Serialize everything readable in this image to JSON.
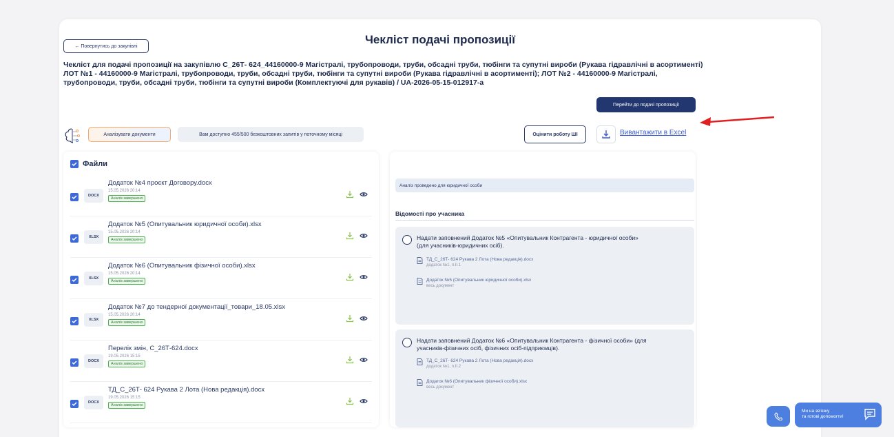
{
  "page": {
    "title": "Чекліст подачі пропозиції",
    "back_label": "← Повернутись до закупівлі",
    "heading": "Чекліст для подачі пропозиції на закупівлю С_26Т- 624_44160000-9 Магістралі, трубопроводи, труби, обсадні труби, тюбінги та супутні вироби (Рукава гідравлічні в асортименті) ЛОТ №1 - 44160000-9 Магістралі, трубопроводи, труби, обсадні труби, тюбінги та супутні вироби (Рукава гідравлічні в асортименті); ЛОТ №2 - 44160000-9 Магістралі, трубопроводи, труби, обсадні труби, тюбінги та супутні вироби (Комплектуючі для рукавів) / UA-2026-05-15-012917-a",
    "submit_label": "Перейти до подачі пропозиції"
  },
  "toolbar": {
    "analyze_label": "Аналізувати документи",
    "quota_text": "Вам доступно 455/500 безкоштовних запитів у поточному місяці",
    "rate_label": "Оцінити роботу ШІ",
    "export_label": "Вивантажити в Excel"
  },
  "files": {
    "header": "Файли",
    "items": [
      {
        "ext": "DOCX",
        "name": "Додаток №4 проєкт Договору.docx",
        "date": "15.05.2026 20:14",
        "status": "Аналіз завершено"
      },
      {
        "ext": "XLSX",
        "name": "Додаток №5 (Опитувальник юридичної особи).xlsx",
        "date": "15.05.2026 20:14",
        "status": "Аналіз завершено"
      },
      {
        "ext": "XLSX",
        "name": "Додаток №6 (Опитувальник фізичної особи).xlsx",
        "date": "15.05.2026 20:14",
        "status": "Аналіз завершено"
      },
      {
        "ext": "XLSX",
        "name": "Додаток №7 до тендерної документації_товари_18.05.xlsx",
        "date": "15.05.2026 20:14",
        "status": "Аналіз завершено"
      },
      {
        "ext": "DOCX",
        "name": "Перелік змін, С_26Т-624.docx",
        "date": "19.05.2026 15:15",
        "status": "Аналіз завершено"
      },
      {
        "ext": "DOCX",
        "name": "ТД_С_26Т- 624 Рукава 2 Лота (Нова редакція).docx",
        "date": "19.05.2026 15:15",
        "status": "Аналіз завершено"
      }
    ]
  },
  "analysis": {
    "note": "Аналіз проведено для юридичної особи",
    "section_title": "Відомості про учасника",
    "requirements": [
      {
        "text": "Надати заповнений Додаток №5 «Опитувальник Контрагента - юридичної особи» (для учасників-юридичних осіб).",
        "refs": [
          {
            "doc": "ТД_С_26Т- 624 Рукава 2 Лота (Нова редакція).docx",
            "loc": "додаток №1, п.II.1"
          },
          {
            "doc": "Додаток №5 (Опитувальник юридичної особи).xlsx",
            "loc": "весь документ"
          }
        ]
      },
      {
        "text": "Надати заповнений Додаток №6 «Опитувальник Контрагента - фізичної особи» (для учасників-фізичних осіб, фізичних осіб-підприємців).",
        "refs": [
          {
            "doc": "ТД_С_26Т- 624 Рукава 2 Лота (Нова редакція).docx",
            "loc": "додаток №1, п.II.2"
          },
          {
            "doc": "Додаток №6 (Опитувальник фізичної особи).xlsx",
            "loc": "весь документ"
          }
        ]
      }
    ]
  },
  "chat": {
    "line1": "Ми на зв'язку",
    "line2": "та готові допомогти!"
  },
  "colors": {
    "primary": "#223670",
    "accent": "#3d6ad6",
    "success": "#4caf50",
    "arrow": "#e02020"
  }
}
